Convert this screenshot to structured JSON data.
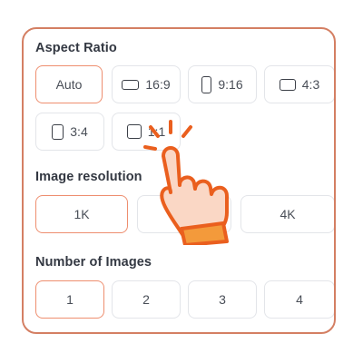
{
  "aspect_ratio": {
    "title": "Aspect Ratio",
    "options": [
      {
        "label": "Auto",
        "icon": null,
        "selected": true
      },
      {
        "label": "16:9",
        "icon": "landscape-rect-icon",
        "selected": false
      },
      {
        "label": "9:16",
        "icon": "portrait-rect-icon",
        "selected": false
      },
      {
        "label": "4:3",
        "icon": "landscape-rect-icon",
        "selected": false
      },
      {
        "label": "3:4",
        "icon": "portrait-rect-icon",
        "selected": false
      },
      {
        "label": "1:1",
        "icon": "square-icon",
        "selected": false
      }
    ]
  },
  "image_resolution": {
    "title": "Image resolution",
    "options": [
      {
        "label": "1K",
        "selected": true
      },
      {
        "label": "2K",
        "selected": false
      },
      {
        "label": "4K",
        "selected": false
      }
    ]
  },
  "number_of_images": {
    "title": "Number of Images",
    "options": [
      {
        "label": "1",
        "selected": true
      },
      {
        "label": "2",
        "selected": false
      },
      {
        "label": "3",
        "selected": false
      },
      {
        "label": "4",
        "selected": false
      }
    ]
  },
  "colors": {
    "panel_border": "#d47f63",
    "selected_border": "#ee8e6f",
    "hand_outline": "#ea5f1e",
    "hand_fill": "#fad7c5",
    "cuff": "#f39a3b"
  },
  "overlay": {
    "icon": "tap-hand-cursor-icon"
  }
}
